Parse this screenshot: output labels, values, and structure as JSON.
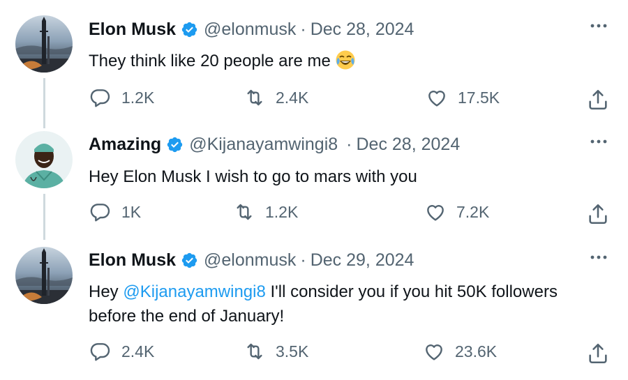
{
  "tweets": [
    {
      "name": "Elon Musk",
      "handle": "@elonmusk",
      "separator": "·",
      "date": "Dec 28, 2024",
      "text": "They think like 20 people are me",
      "emoji_icon": "face-with-tears-of-joy-icon",
      "replies": "1.2K",
      "retweets": "2.4K",
      "likes": "17.5K"
    },
    {
      "name": "Amazing",
      "handle": "@Kijanayamwingi8",
      "separator": "·",
      "date": "Dec 28, 2024",
      "text": "Hey Elon Musk I wish to go to mars with you",
      "replies": "1K",
      "retweets": "1.2K",
      "likes": "7.2K"
    },
    {
      "name": "Elon Musk",
      "handle": "@elonmusk",
      "separator": "·",
      "date": "Dec 29, 2024",
      "text_before": "Hey ",
      "mention": "@Kijanayamwingi8",
      "text_after": " I'll consider you if you hit 50K followers",
      "text_line2": "before the end of January!",
      "replies": "2.4K",
      "retweets": "3.5K",
      "likes": "23.6K"
    }
  ],
  "colors": {
    "text": "#0f1419",
    "secondary": "#536471",
    "accent": "#1d9bf0",
    "thread_line": "#cfd9de"
  },
  "icons": [
    "verified-badge-icon",
    "more-icon",
    "reply-icon",
    "retweet-icon",
    "like-icon",
    "share-icon"
  ]
}
